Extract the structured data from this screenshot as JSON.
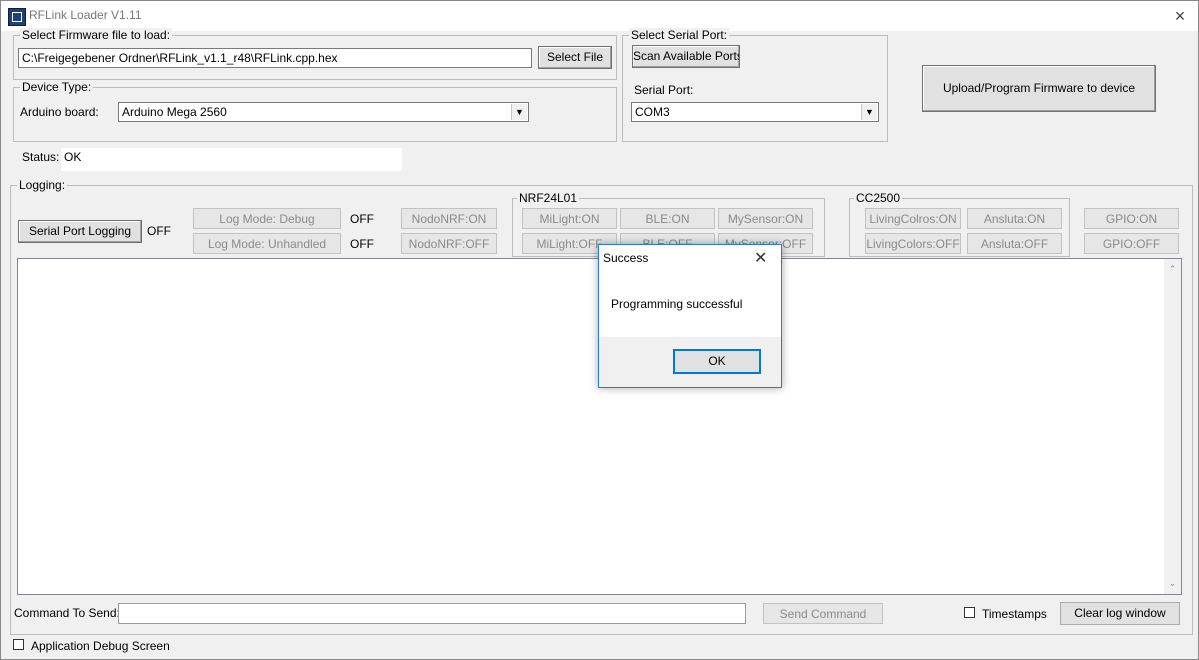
{
  "window": {
    "title": "RFLink Loader V1.11",
    "close_icon": "×"
  },
  "firmware": {
    "legend": "Select Firmware file to load:",
    "path": "C:\\Freigegebener Ordner\\RFLink_v1.1_r48\\RFLink.cpp.hex",
    "select_file_label": "Select File"
  },
  "device": {
    "legend": "Device Type:",
    "board_label": "Arduino board:",
    "board_value": "Arduino Mega 2560"
  },
  "serial": {
    "legend": "Select Serial Port:",
    "scan_label": "Scan Available Ports",
    "port_label": "Serial Port:",
    "port_value": "COM3"
  },
  "upload_label": "Upload/Program Firmware to device",
  "status": {
    "label": "Status:",
    "value": "OK"
  },
  "logging": {
    "legend": "Logging:",
    "serial_port_logging_label": "Serial Port Logging",
    "serial_port_logging_state": "OFF",
    "log_mode_debug_label": "Log Mode: Debug",
    "log_mode_debug_state": "OFF",
    "log_mode_unhandled_label": "Log Mode: Unhandled",
    "log_mode_unhandled_state": "OFF",
    "nodo_on": "NodoNRF:ON",
    "nodo_off": "NodoNRF:OFF",
    "nrf_legend": "NRF24L01",
    "milight_on": "MiLight:ON",
    "milight_off": "MiLight:OFF",
    "ble_on": "BLE:ON",
    "ble_off": "BLE:OFF",
    "mysensor_on": "MySensor:ON",
    "mysensor_off": "MySensor:OFF",
    "cc_legend": "CC2500",
    "livingcolors_on": "LivingColros:ON",
    "livingcolors_off": "LivingColors:OFF",
    "ansluta_on": "Ansluta:ON",
    "ansluta_off": "Ansluta:OFF",
    "gpio_on": "GPIO:ON",
    "gpio_off": "GPIO:OFF"
  },
  "command": {
    "label": "Command To Send:",
    "value": "",
    "send_label": "Send Command",
    "timestamps_label": "Timestamps",
    "clear_label": "Clear log window"
  },
  "debug_screen_label": "Application Debug Screen",
  "dialog": {
    "title": "Success",
    "close_icon": "✕",
    "message": "Programming successful",
    "ok_label": "OK"
  },
  "scroll": {
    "up_icon": "⌃",
    "down_icon": "⌄"
  }
}
